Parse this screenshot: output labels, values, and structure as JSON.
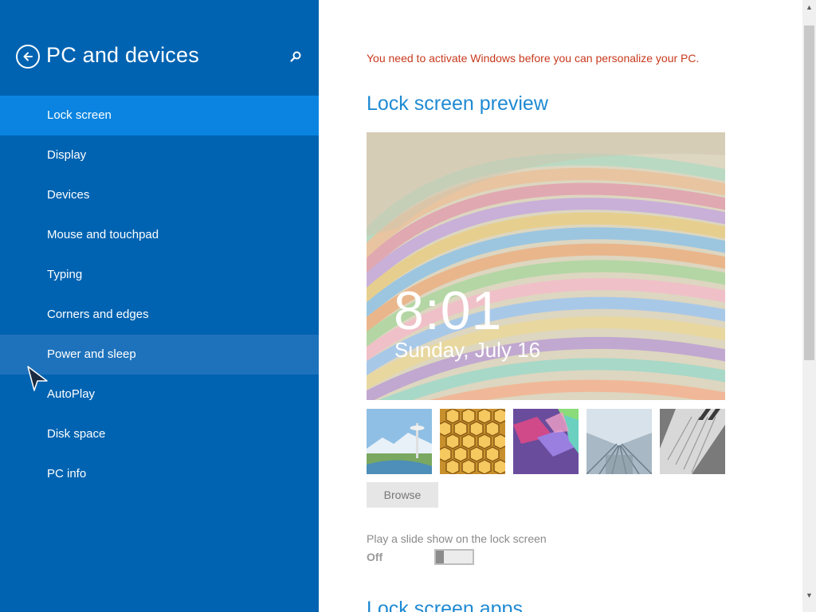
{
  "sidebar": {
    "title": "PC and devices",
    "items": [
      {
        "label": "Lock screen",
        "state": "selected"
      },
      {
        "label": "Display"
      },
      {
        "label": "Devices"
      },
      {
        "label": "Mouse and touchpad"
      },
      {
        "label": "Typing"
      },
      {
        "label": "Corners and edges"
      },
      {
        "label": "Power and sleep",
        "state": "hover"
      },
      {
        "label": "AutoPlay"
      },
      {
        "label": "Disk space"
      },
      {
        "label": "PC info"
      }
    ],
    "back_icon": "back-arrow-icon",
    "search_icon": "search-icon"
  },
  "main": {
    "activation_notice": "You need to activate Windows before you can personalize your PC.",
    "preview_title": "Lock screen preview",
    "preview_time": "8:01",
    "preview_date": "Sunday, July 16",
    "thumbnails": [
      {
        "name": "space-needle-thumbnail"
      },
      {
        "name": "honeycomb-thumbnail"
      },
      {
        "name": "geometric-shapes-thumbnail"
      },
      {
        "name": "escalator-thumbnail"
      },
      {
        "name": "piano-keys-thumbnail"
      }
    ],
    "browse_label": "Browse",
    "slideshow_label": "Play a slide show on the lock screen",
    "slideshow_state": "Off",
    "apps_title": "Lock screen apps"
  },
  "colors": {
    "sidebar_bg": "#0063b1",
    "selected_bg": "#0a84e0",
    "accent": "#1f8ad3",
    "warning": "#c83a1e"
  }
}
